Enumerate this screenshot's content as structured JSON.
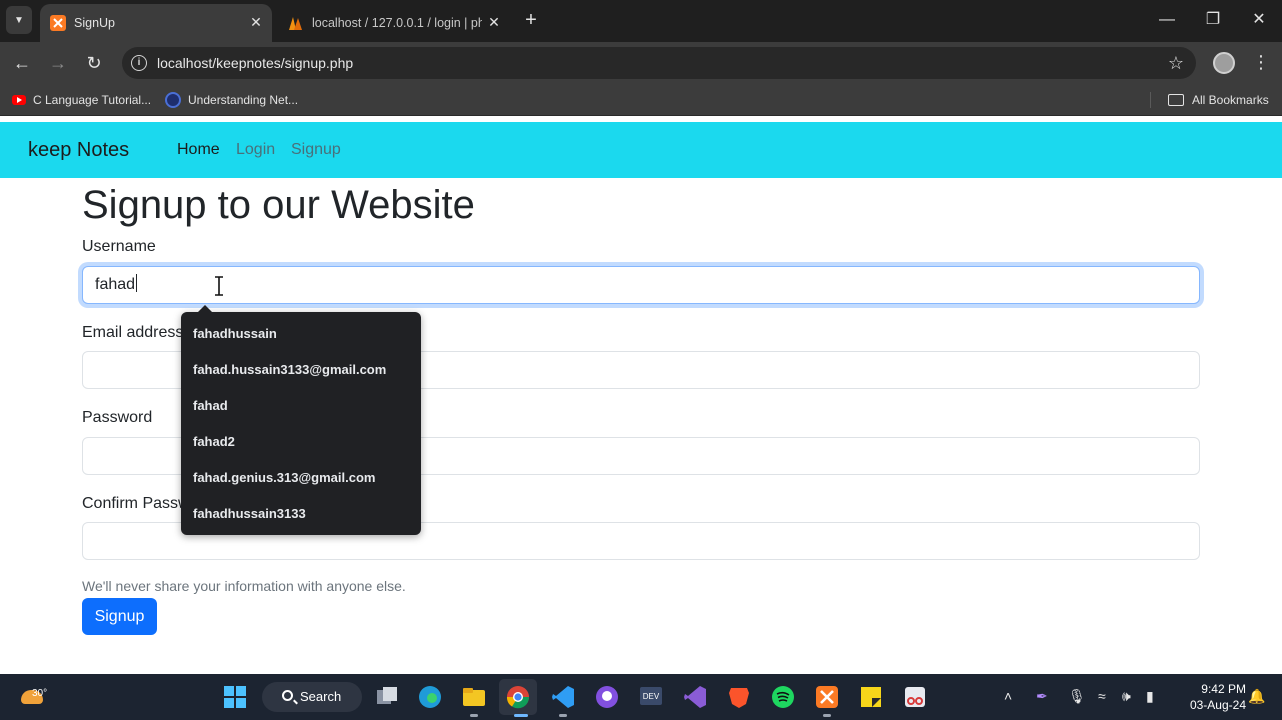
{
  "browser": {
    "tabs": [
      {
        "title": "SignUp",
        "active": true
      },
      {
        "title": "localhost / 127.0.0.1 / login | ph",
        "active": false
      }
    ],
    "url": "localhost/keepnotes/signup.php",
    "bookmarks": [
      {
        "label": "C Language Tutorial...",
        "icon": "youtube-icon"
      },
      {
        "label": "Understanding Net...",
        "icon": "globe-icon"
      }
    ],
    "all_bookmarks_label": "All Bookmarks"
  },
  "site": {
    "brand": "keep Notes",
    "nav": {
      "home": "Home",
      "login": "Login",
      "signup": "Signup"
    }
  },
  "form": {
    "title": "Signup to our Website",
    "username_label": "Username",
    "username_value": "fahad",
    "email_label": "Email address",
    "password_label": "Password",
    "confirm_label": "Confirm Password",
    "help_text": "We'll never share your information with anyone else.",
    "submit_label": "Signup"
  },
  "autocomplete": [
    "fahadhussain",
    "fahad.hussain3133@gmail.com",
    "fahad",
    "fahad2",
    "fahad.genius.313@gmail.com",
    "fahadhussain3133"
  ],
  "taskbar": {
    "temperature": "30°",
    "search_label": "Search",
    "time": "9:42 PM",
    "date": "03-Aug-24"
  },
  "colors": {
    "navbar": "#1bd9ee",
    "primary": "#0d6efd",
    "chrome_dark": "#3c3c3c"
  }
}
